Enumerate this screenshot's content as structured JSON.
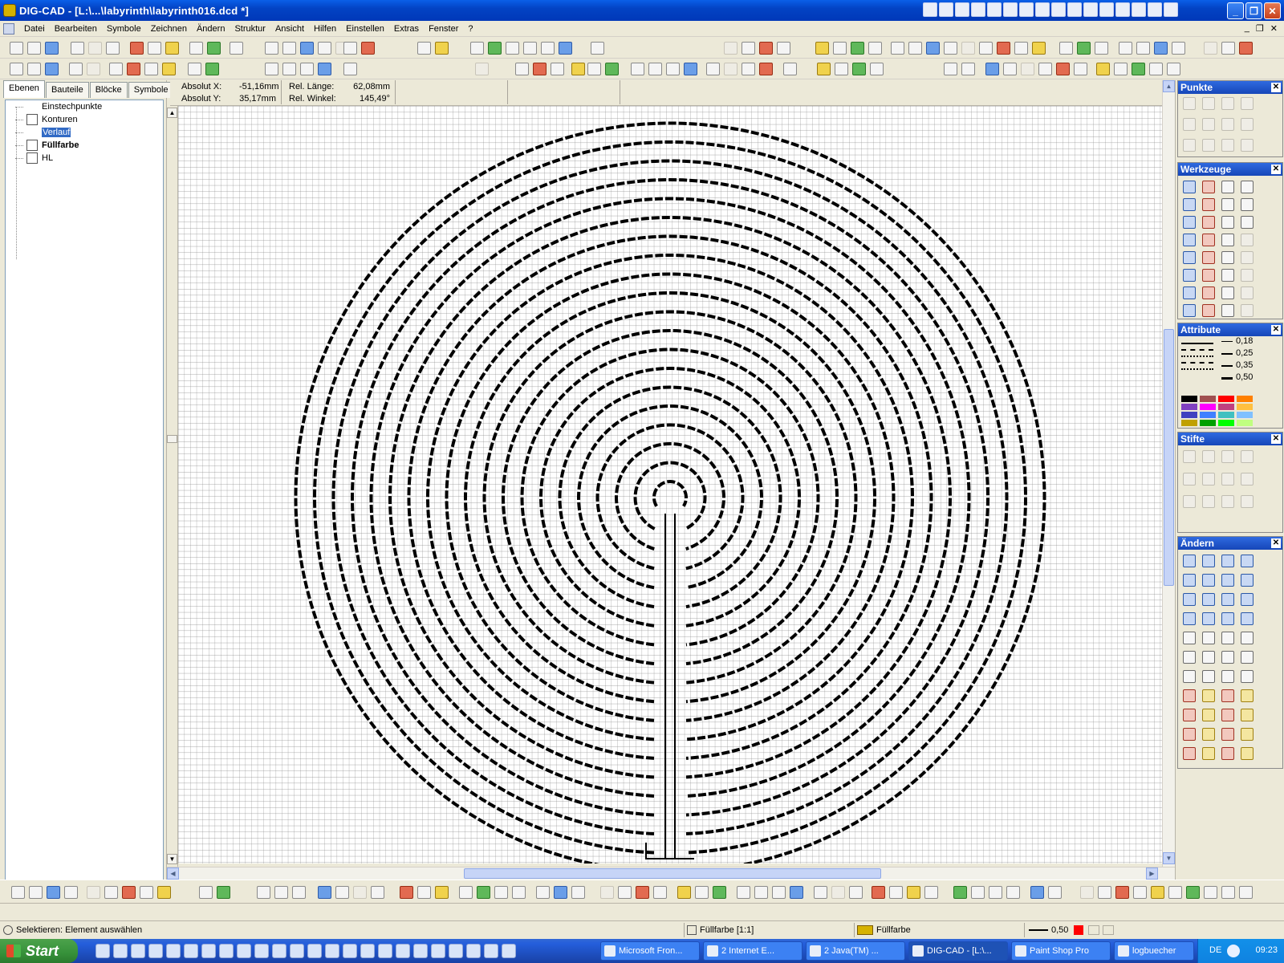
{
  "window": {
    "title": "DIG-CAD - [L:\\...\\labyrinth\\labyrinth016.dcd *]"
  },
  "menu": [
    "Datei",
    "Bearbeiten",
    "Symbole",
    "Zeichnen",
    "Ändern",
    "Struktur",
    "Ansicht",
    "Hilfen",
    "Einstellen",
    "Extras",
    "Fenster",
    "?"
  ],
  "panel_tabs": [
    "Ebenen",
    "Bauteile",
    "Blöcke",
    "Symbole"
  ],
  "layers": [
    {
      "label": "Einstechpunkte",
      "selected": false,
      "bold": false
    },
    {
      "label": "Konturen",
      "selected": false,
      "bold": false
    },
    {
      "label": "Verlauf",
      "selected": true,
      "bold": false
    },
    {
      "label": "Füllfarbe",
      "selected": false,
      "bold": true
    },
    {
      "label": "HL",
      "selected": false,
      "bold": false
    }
  ],
  "coordinates": {
    "abs_x_label": "Absolut X:",
    "abs_x_value": "-51,16mm",
    "abs_y_label": "Absolut Y:",
    "abs_y_value": "35,17mm",
    "rel_len_label": "Rel. Länge:",
    "rel_len_value": "62,08mm",
    "rel_angle_label": "Rel. Winkel:",
    "rel_angle_value": "145,49°"
  },
  "palettes": {
    "punkte": "Punkte",
    "werkzeuge": "Werkzeuge",
    "attribute": "Attribute",
    "stifte": "Stifte",
    "aendern": "Ändern"
  },
  "line_widths": [
    "0,18",
    "0,25",
    "0,35",
    "0,50"
  ],
  "color_swatches": [
    "#000000",
    "#a05050",
    "#ff0000",
    "#ff8000",
    "#8040c0",
    "#ff00ff",
    "#c04080",
    "#ffc040",
    "#4040c0",
    "#4080ff",
    "#40c0c0",
    "#80c0ff",
    "#c0a000",
    "#00a000",
    "#00ff00",
    "#c0ff80"
  ],
  "status": {
    "message": "Selektieren: Element auswählen",
    "layer_info": "Füllfarbe [1:1]",
    "layer_name": "Füllfarbe",
    "line_width": "0,50",
    "pen_color": "#ff0000"
  },
  "taskbar": {
    "start": "Start",
    "tasks": [
      "Microsoft Fron...",
      "2 Internet E...",
      "2 Java(TM) ...",
      "DIG-CAD - [L:\\...",
      "Paint Shop Pro",
      "logbuecher"
    ],
    "active_task_index": 3,
    "language": "DE",
    "clock": "09:23"
  }
}
